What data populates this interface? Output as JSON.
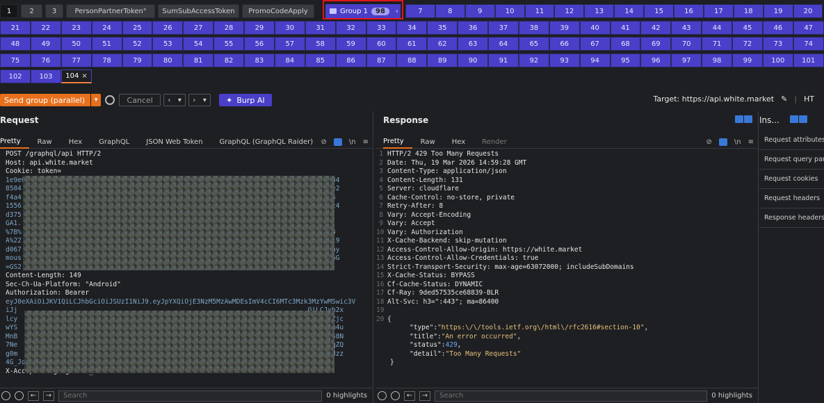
{
  "tabs_row1": {
    "left": [
      "1",
      "2",
      "3",
      "PersonPartnerToken\"",
      "SumSubAccessToken",
      "PromoCodeApply"
    ],
    "group": {
      "label": "Group 1",
      "count": "98"
    },
    "right": [
      "7",
      "8",
      "9",
      "10",
      "11",
      "12",
      "13",
      "14",
      "15",
      "16",
      "17",
      "18",
      "19",
      "20"
    ]
  },
  "tabs_row2": [
    "21",
    "22",
    "23",
    "24",
    "25",
    "26",
    "27",
    "28",
    "29",
    "30",
    "31",
    "32",
    "33",
    "34",
    "35",
    "36",
    "37",
    "38",
    "39",
    "40",
    "41",
    "42",
    "43",
    "44",
    "45",
    "46",
    "47"
  ],
  "tabs_row3": [
    "48",
    "49",
    "50",
    "51",
    "52",
    "53",
    "54",
    "55",
    "56",
    "57",
    "58",
    "59",
    "60",
    "61",
    "62",
    "63",
    "64",
    "65",
    "66",
    "67",
    "68",
    "69",
    "70",
    "71",
    "72",
    "73",
    "74"
  ],
  "tabs_row4": [
    "75",
    "76",
    "77",
    "78",
    "79",
    "80",
    "81",
    "82",
    "83",
    "84",
    "85",
    "86",
    "87",
    "88",
    "89",
    "90",
    "91",
    "92",
    "93",
    "94",
    "95",
    "96",
    "97",
    "98",
    "99",
    "100",
    "101"
  ],
  "tabs_row5": [
    "102",
    "103",
    "104"
  ],
  "toolbar": {
    "send_label": "Send group (parallel)",
    "cancel_label": "Cancel",
    "burp_ai_label": "Burp AI",
    "target_label": "Target: https://api.white.market",
    "http_label": "HT"
  },
  "request": {
    "title": "Request",
    "tabs": [
      "Pretty",
      "Raw",
      "Hex",
      "GraphQL",
      "JSON Web Token",
      "GraphQL (GraphQL Raider)"
    ],
    "lines": [
      "POST /graphql/api HTTP/2",
      "Host: api.white.market",
      "Cookie: token=",
      "1e9e07e3d917f896e43466110652471456e4c74677f6e3438424d7e5050463484f77703037306969b484",
      "8504                                                                        36b354e2",
      "f4a4                                                                        6f37324",
      "1556                                                                        36e354c4",
      "d375",
      "GA1.",
      "%7B%                                                                        id%22%3",
      "A%22                                                                        2C%22019",
      "d067                                                                        %22anony",
      "mous                                                                        2Y04446G",
      "=GS2.",
      "Content-Length: 149",
      "Sec-Ch-Ua-Platform: \"Android\"",
      "Authorization: Bearer",
      "eyJ0eXAiOiJKV1QiLCJhbGciOiJSUzI1NiJ9.eyJpYXQiOjE3NzM5MzAwMDEsImV4cCI6MTc3Mzk3MzYwMSwic3V",
      "iJj                                                                         QiLCJyb2x",
      "lcy                                                                         kz0DI2Zjc",
      "wYS                                                                         hyHLELm4u",
      "MnB                                                                         8s07lU48N",
      "7Ne                                                                         mDKPUbqZQ",
      "g0m                                                                         CIxQMPdzz",
      "4G_JqofPkx8WDg",
      "X-Accept-Language: en_US"
    ],
    "highlights": "0 highlights",
    "search_placeholder": "Search"
  },
  "response": {
    "title": "Response",
    "tabs": [
      "Pretty",
      "Raw",
      "Hex",
      "Render"
    ],
    "lines": [
      "HTTP/2 429 Too Many Requests",
      "Date: Thu, 19 Mar 2026 14:59:28 GMT",
      "Content-Type: application/json",
      "Content-Length: 131",
      "Server: cloudflare",
      "Cache-Control: no-store, private",
      "Retry-After: 8",
      "Vary: Accept-Encoding",
      "Vary: Accept",
      "Vary: Authorization",
      "X-Cache-Backend: skip-mutation",
      "Access-Control-Allow-Origin: https://white.market",
      "Access-Control-Allow-Credentials: true",
      "Strict-Transport-Security: max-age=63072000; includeSubDomains",
      "X-Cache-Status: BYPASS",
      "Cf-Cache-Status: DYNAMIC",
      "Cf-Ray: 9ded57535ce68839-BLR",
      "Alt-Svc: h3=\":443\"; ma=86400",
      "",
      "{"
    ],
    "json_body": [
      {
        "key": "\"type\"",
        "val": "\"https:\\/\\/tools.ietf.org\\/html\\/rfc2616#section-10\"",
        "tail": ","
      },
      {
        "key": "\"title\"",
        "val": "\"An error occurred\"",
        "tail": ","
      },
      {
        "key": "\"status\"",
        "val": "429",
        "tail": ",",
        "num": true
      },
      {
        "key": "\"detail\"",
        "val": "\"Too Many Requests\"",
        "tail": ""
      }
    ],
    "close_brace": "}",
    "highlights": "0 highlights",
    "search_placeholder": "Search"
  },
  "inspector": {
    "title": "Ins...",
    "items": [
      "Request attributes",
      "Request query param",
      "Request cookies",
      "Request headers",
      "Response headers"
    ]
  }
}
